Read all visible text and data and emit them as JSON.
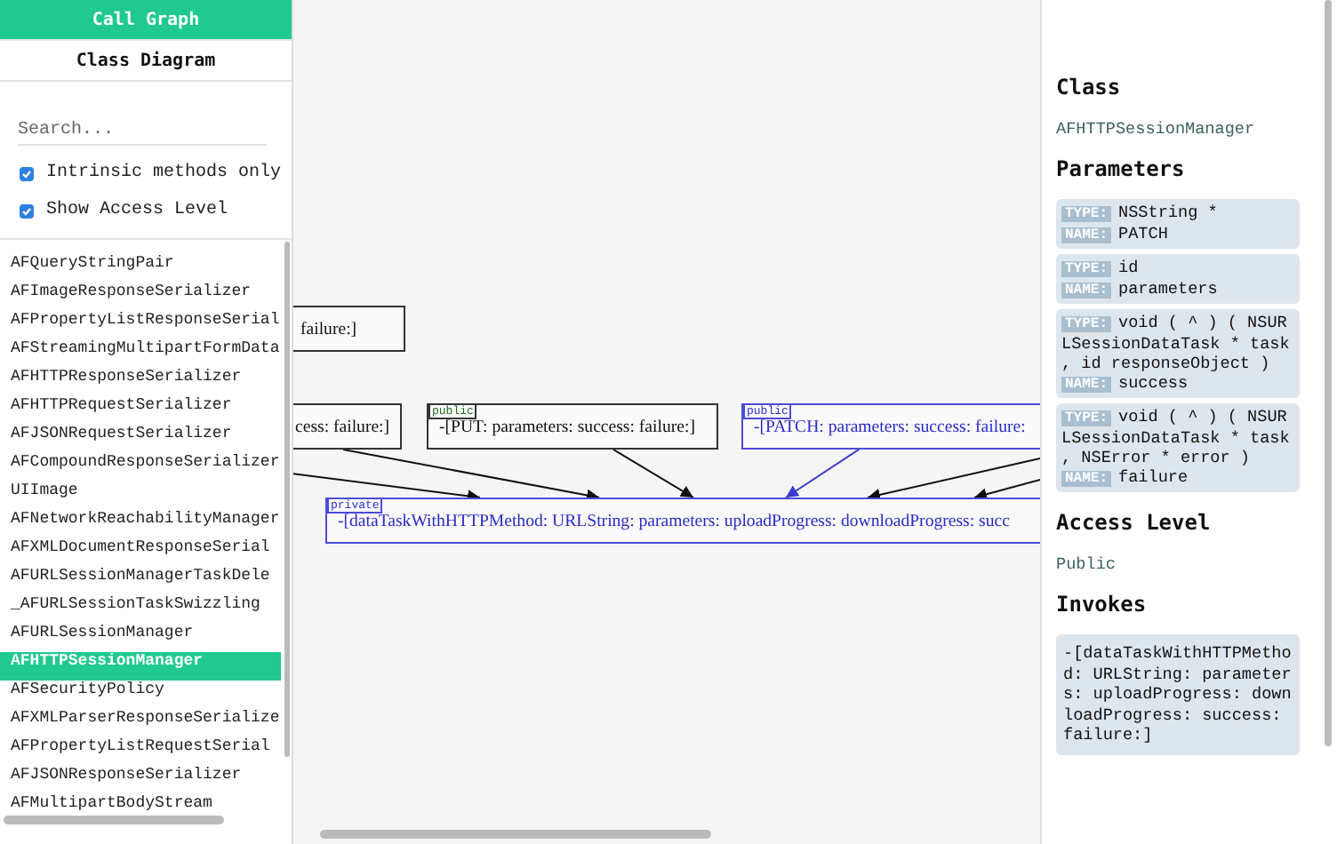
{
  "tabs": [
    {
      "label": "Call Graph",
      "selected": true
    },
    {
      "label": "Class Diagram",
      "selected": false
    }
  ],
  "search": {
    "placeholder": "Search..."
  },
  "options": [
    {
      "label": "Intrinsic methods only",
      "checked": true
    },
    {
      "label": "Show Access Level",
      "checked": true
    }
  ],
  "classes": [
    {
      "name": "AFQueryStringPair",
      "selected": false
    },
    {
      "name": "AFImageResponseSerializer",
      "selected": false
    },
    {
      "name": "AFPropertyListResponseSerial",
      "selected": false
    },
    {
      "name": "AFStreamingMultipartFormData",
      "selected": false
    },
    {
      "name": "AFHTTPResponseSerializer",
      "selected": false
    },
    {
      "name": "AFHTTPRequestSerializer",
      "selected": false
    },
    {
      "name": "AFJSONRequestSerializer",
      "selected": false
    },
    {
      "name": "AFCompoundResponseSerializer",
      "selected": false
    },
    {
      "name": "UIImage",
      "selected": false
    },
    {
      "name": "AFNetworkReachabilityManager",
      "selected": false
    },
    {
      "name": "AFXMLDocumentResponseSerial",
      "selected": false
    },
    {
      "name": "AFURLSessionManagerTaskDele",
      "selected": false
    },
    {
      "name": "_AFURLSessionTaskSwizzling",
      "selected": false
    },
    {
      "name": "AFURLSessionManager",
      "selected": false
    },
    {
      "name": "AFHTTPSessionManager",
      "selected": true
    },
    {
      "name": "AFSecurityPolicy",
      "selected": false
    },
    {
      "name": "AFXMLParserResponseSerialize",
      "selected": false
    },
    {
      "name": "AFPropertyListRequestSerial",
      "selected": false
    },
    {
      "name": "AFJSONResponseSerializer",
      "selected": false
    },
    {
      "name": "AFMultipartBodyStream",
      "selected": false
    }
  ],
  "graph": {
    "nodes": [
      {
        "text": "failure:]",
        "highlighted": false
      },
      {
        "text": "cess: failure:]",
        "highlighted": false
      },
      {
        "access": "public",
        "text": "-[PUT: parameters: success: failure:]",
        "highlighted": false
      },
      {
        "access": "public",
        "text": "-[PATCH: parameters: success: failure:",
        "highlighted": true
      },
      {
        "access": "private",
        "text": "-[dataTaskWithHTTPMethod: URLString: parameters: uploadProgress: downloadProgress: succ",
        "highlighted": true
      }
    ]
  },
  "details": {
    "class_heading": "Class",
    "class_name": "AFHTTPSessionManager",
    "parameters_heading": "Parameters",
    "parameters": [
      {
        "type_label": "TYPE:",
        "type": "NSString *",
        "name_label": "NAME:",
        "name": "PATCH"
      },
      {
        "type_label": "TYPE:",
        "type": "id",
        "name_label": "NAME:",
        "name": "parameters"
      },
      {
        "type_label": "TYPE:",
        "type": "void ( ^ ) ( NSURLSessionDataTask * task , id responseObject )",
        "name_label": "NAME:",
        "name": "success"
      },
      {
        "type_label": "TYPE:",
        "type": "void ( ^ ) ( NSURLSessionDataTask * task , NSError * error )",
        "name_label": "NAME:",
        "name": "failure"
      }
    ],
    "access_heading": "Access Level",
    "access_level": "Public",
    "invokes_heading": "Invokes",
    "invokes": [
      "-[dataTaskWithHTTPMethod: URLString: parameters: uploadProgress: downloadProgress: success: failure:]"
    ]
  }
}
